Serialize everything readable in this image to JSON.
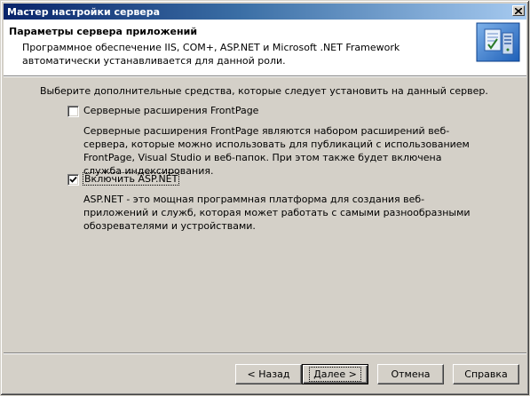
{
  "window": {
    "title": "Мастер настройки сервера",
    "close_icon": "close-icon"
  },
  "header": {
    "heading": "Параметры сервера приложений",
    "description": "Программное обеспечение IIS, COM+, ASP.NET и Microsoft .NET Framework автоматически устанавливается для данной роли.",
    "icon": "server-wizard-icon"
  },
  "body": {
    "instruction": "Выберите дополнительные средства, которые следует установить на данный сервер.",
    "options": [
      {
        "label": "Серверные расширения FrontPage",
        "checked": false,
        "description": "Серверные расширения FrontPage являются набором расширений веб-сервера, которые можно использовать для публикаций с использованием FrontPage, Visual Studio и веб-папок. При этом также будет включена служба индексирования."
      },
      {
        "label": "Включить ASP.NET",
        "checked": true,
        "description": "ASP.NET - это мощная программная платформа для создания веб-приложений и служб, которая может работать с самыми разнообразными обозревателями и устройствами."
      }
    ]
  },
  "buttons": {
    "back": "< Назад",
    "next": "Далее >",
    "cancel": "Отмена",
    "help": "Справка"
  }
}
